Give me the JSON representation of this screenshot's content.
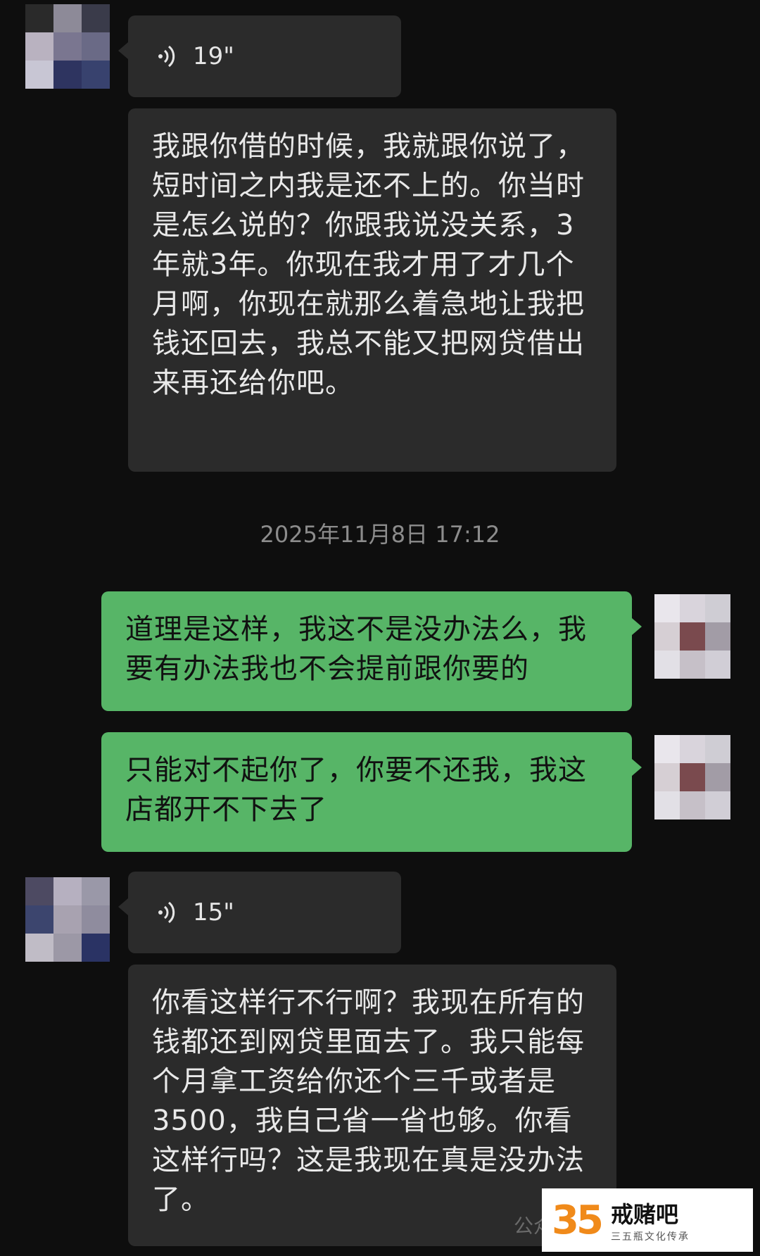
{
  "messages": {
    "voice1": {
      "duration": "19\""
    },
    "text1": "我跟你借的时候，我就跟你说了，短时间之内我是还不上的。你当时是怎么说的？你跟我说没关系，3年就3年。你现在我才用了才几个月啊，你现在就那么着急地让我把钱还回去，我总不能又把网贷借出来再还给你吧。",
    "timestamp": "2025年11月8日 17:12",
    "sent1": "道理是这样，我这不是没办法么，我要有办法我也不会提前跟你要的",
    "sent2": "只能对不起你了，你要不还我，我这店都开不下去了",
    "voice2": {
      "duration": "15\""
    },
    "text2": "你看这样行不行啊？我现在所有的钱都还到网贷里面去了。我只能每个月拿工资给你还个三千或者是3500，我自己省一省也够。你看这样行吗？这是我现在真是没办法了。"
  },
  "watermark": {
    "number": "35",
    "title": "戒赌吧",
    "subtitle": "三五瓶文化传承",
    "behind_text": "公众号"
  },
  "colors": {
    "sent_bubble": "#57b567",
    "recv_bubble": "#2b2b2b",
    "background": "#0e0e0e",
    "watermark_accent": "#f08a1a"
  }
}
